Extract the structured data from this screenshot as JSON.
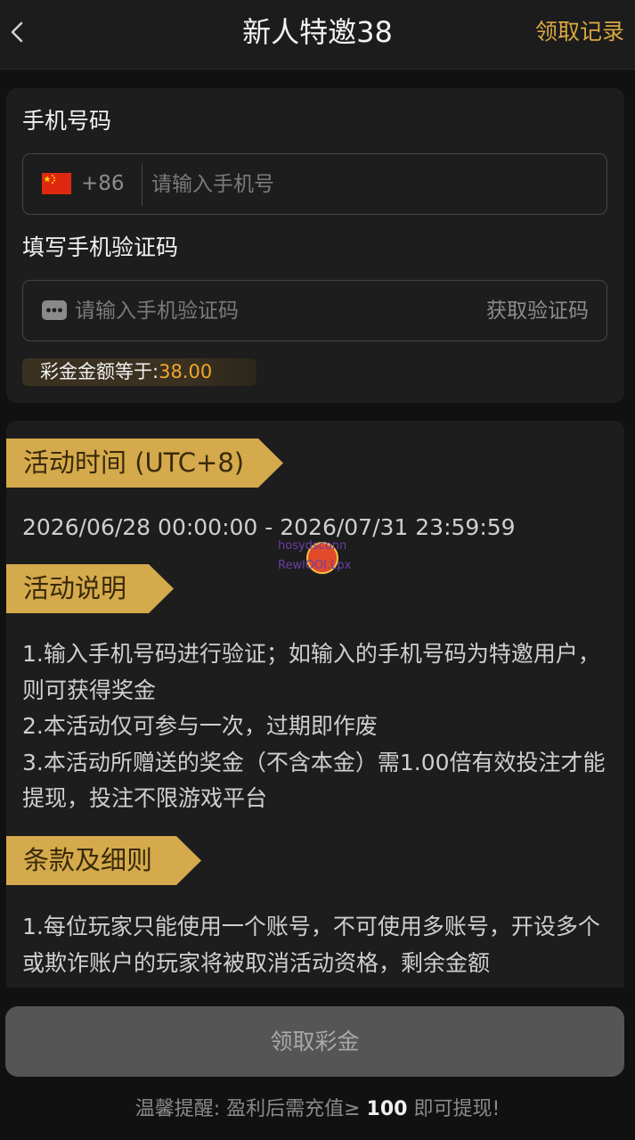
{
  "header": {
    "title": "新人特邀38",
    "records_label": "领取记录"
  },
  "form": {
    "phone_label": "手机号码",
    "dial_code": "+86",
    "phone_placeholder": "请输入手机号",
    "code_label": "填写手机验证码",
    "code_placeholder": "请输入手机验证码",
    "get_code_label": "获取验证码",
    "bonus_label": "彩金金额等于:",
    "bonus_value": "38.00"
  },
  "info": {
    "time_title": "活动时间 (UTC+8)",
    "time_range": "2026/06/28 00:00:00 - 2026/07/31 23:59:59",
    "desc_title": "活动说明",
    "desc_lines": [
      "1.输入手机号码进行验证；如输入的手机号码为特邀用户，则可获得奖金",
      "2.本活动仅可参与一次，过期即作废",
      "3.本活动所赠送的奖金（不含本金）需1.00倍有效投注才能提现，投注不限游戏平台"
    ],
    "terms_title": "条款及细则",
    "terms_lines": [
      "1.每位玩家只能使用一个账号，不可使用多账号，开设多个或欺诈账户的玩家将被取消活动资格，剩余金额"
    ],
    "watermark_top": "hosydsconn",
    "watermark_bottom": "RewlOOI.Lpx"
  },
  "footer": {
    "claim_label": "领取彩金",
    "reminder_prefix": "温馨提醒: 盈利后需充值≥ ",
    "reminder_amount": "100",
    "reminder_suffix": " 即可提现!"
  },
  "colors": {
    "accent_gold": "#d4aa4c",
    "link_gold": "#d9a742",
    "bonus_orange": "#f0a72a"
  },
  "icons": [
    "back-icon",
    "china-flag-icon",
    "sms-icon"
  ]
}
